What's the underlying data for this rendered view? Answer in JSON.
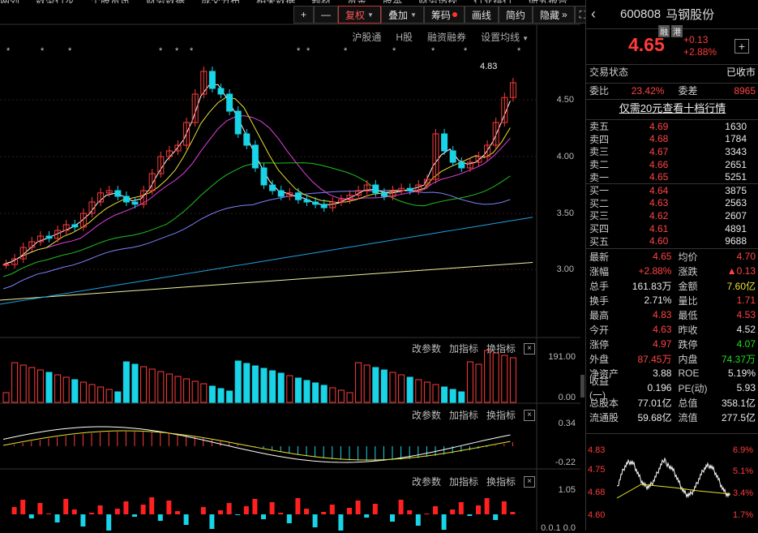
{
  "top_nav_fragments": [
    "两列",
    "数型行步",
    "个股资讯",
    "财务数据",
    "成交分布",
    "相关数据",
    "题材",
    "资金",
    "股本",
    "财务透视",
    "行业排行",
    "研究报告"
  ],
  "toolbar": {
    "plus": "+",
    "minus": "—",
    "fuquan": "复权",
    "diejia": "叠加",
    "chouma": "筹码",
    "huaxian": "画线",
    "jianyue": "简约",
    "yincang": "隐藏",
    "arrows": "»",
    "fullscreen": "⛶"
  },
  "subbar": {
    "hgt": "沪股通",
    "h": "H股",
    "rzrq": "融资融券",
    "setma": "设置均线"
  },
  "price_axis": [
    "4.50",
    "4.00",
    "3.50",
    "3.00"
  ],
  "high_label": "4.83",
  "vol_axis": [
    "191.00",
    "0.00"
  ],
  "macd_axis": [
    "0.34",
    "-0.22"
  ],
  "ind3_axis": [
    "1.05"
  ],
  "ind3_bottom": "0.0.1 0.0",
  "panel_tools": {
    "params": "改参数",
    "add": "加指标",
    "switch": "换指标",
    "close": "×"
  },
  "stock": {
    "code": "600808",
    "name": "马钢股份",
    "tag1": "融",
    "tag2": "港",
    "price": "4.65",
    "chg": "+0.13",
    "pct": "+2.88%",
    "add": "+",
    "back": "‹"
  },
  "status": {
    "label": "交易状态",
    "value": "已收市"
  },
  "weibi": {
    "label": "委比",
    "value": "23.42%",
    "label2": "委差",
    "value2": "8965"
  },
  "tenlevel": "仅需20元查看十档行情",
  "asks": [
    {
      "label": "卖五",
      "price": "4.69",
      "vol": "1630"
    },
    {
      "label": "卖四",
      "price": "4.68",
      "vol": "1784"
    },
    {
      "label": "卖三",
      "price": "4.67",
      "vol": "3343"
    },
    {
      "label": "卖二",
      "price": "4.66",
      "vol": "2651"
    },
    {
      "label": "卖一",
      "price": "4.65",
      "vol": "5251"
    }
  ],
  "bids": [
    {
      "label": "买一",
      "price": "4.64",
      "vol": "3875"
    },
    {
      "label": "买二",
      "price": "4.63",
      "vol": "2563"
    },
    {
      "label": "买三",
      "price": "4.62",
      "vol": "2607"
    },
    {
      "label": "买四",
      "price": "4.61",
      "vol": "4891"
    },
    {
      "label": "买五",
      "price": "4.60",
      "vol": "9688"
    }
  ],
  "stats": [
    {
      "l1": "最新",
      "v1": "4.65",
      "c1": "r",
      "l2": "均价",
      "v2": "4.70",
      "c2": "r"
    },
    {
      "l1": "涨幅",
      "v1": "+2.88%",
      "c1": "r",
      "l2": "涨跌",
      "v2": "▲0.13",
      "c2": "r"
    },
    {
      "l1": "总手",
      "v1": "161.83万",
      "c1": "w",
      "l2": "金额",
      "v2": "7.60亿",
      "c2": "y"
    },
    {
      "l1": "换手",
      "v1": "2.71%",
      "c1": "w",
      "l2": "量比",
      "v2": "1.71",
      "c2": "r"
    },
    {
      "l1": "最高",
      "v1": "4.83",
      "c1": "r",
      "l2": "最低",
      "v2": "4.53",
      "c2": "r"
    },
    {
      "l1": "今开",
      "v1": "4.63",
      "c1": "r",
      "l2": "昨收",
      "v2": "4.52",
      "c2": "w"
    },
    {
      "l1": "涨停",
      "v1": "4.97",
      "c1": "r",
      "l2": "跌停",
      "v2": "4.07",
      "c2": "g"
    },
    {
      "l1": "外盘",
      "v1": "87.45万",
      "c1": "r",
      "l2": "内盘",
      "v2": "74.37万",
      "c2": "g"
    },
    {
      "l1": "净资产",
      "v1": "3.88",
      "c1": "w",
      "l2": "ROE",
      "v2": "5.19%",
      "c2": "w"
    },
    {
      "l1": "收益(一)",
      "v1": "0.196",
      "c1": "w",
      "l2": "PE(动)",
      "v2": "5.93",
      "c2": "w"
    },
    {
      "l1": "总股本",
      "v1": "77.01亿",
      "c1": "w",
      "l2": "总值",
      "v2": "358.1亿",
      "c2": "w"
    },
    {
      "l1": "流通股",
      "v1": "59.68亿",
      "c1": "w",
      "l2": "流值",
      "v2": "277.5亿",
      "c2": "w"
    }
  ],
  "mini": {
    "p1": "4.83",
    "p2": "4.75",
    "p3": "4.68",
    "p4": "4.60",
    "r1": "6.9%",
    "r2": "5.1%",
    "r3": "3.4%",
    "r4": "1.7%"
  },
  "colors": {
    "up": "#ff3b3b",
    "down": "#19d3e6",
    "ma5": "#ffffff",
    "ma10": "#e8e030",
    "ma20": "#e040e0",
    "ma30": "#20c020",
    "ma60": "#8080ff",
    "ma120": "#20a0e0",
    "ma250": "#f0f0a0"
  }
}
